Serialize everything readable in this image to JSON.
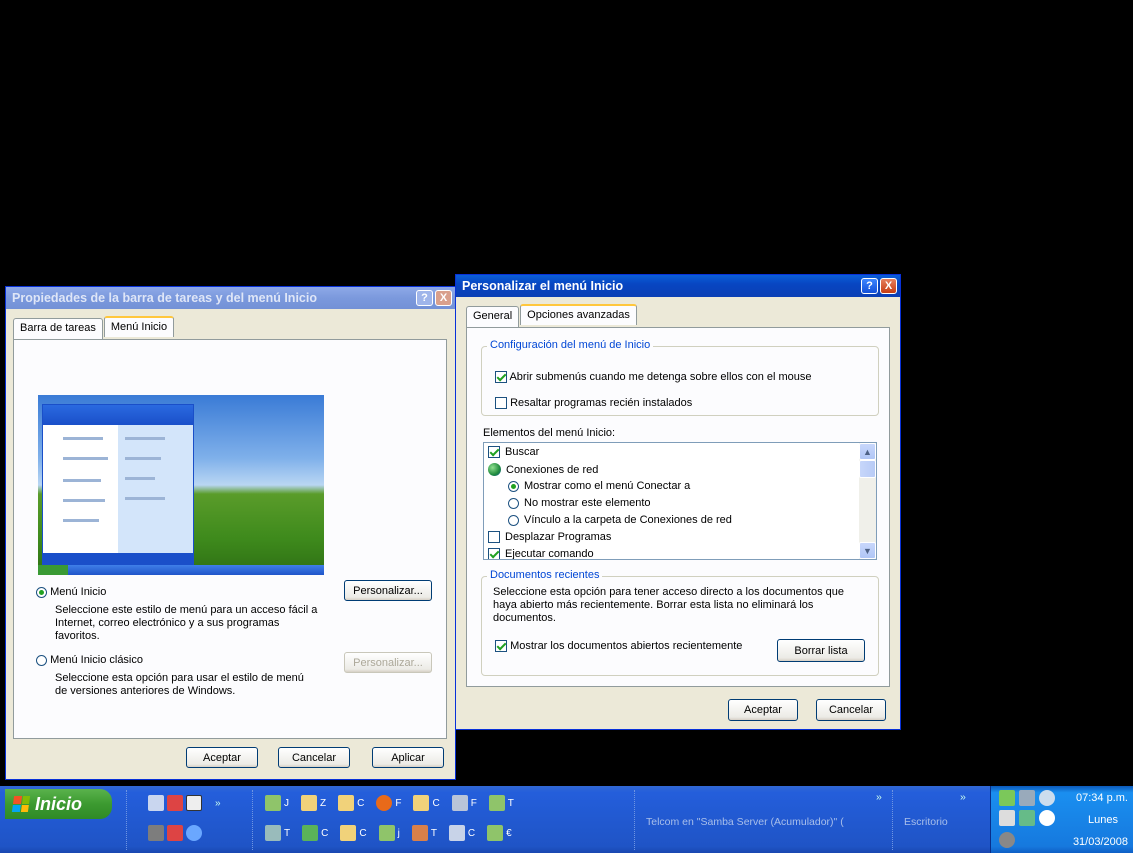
{
  "left_dialog": {
    "title": "Propiedades de la barra de tareas y del menú Inicio",
    "help_label": "?",
    "close_label": "X",
    "tabs": [
      "Barra de tareas",
      "Menú Inicio"
    ],
    "active_tab": "Menú Inicio",
    "option_start_menu": {
      "label": "Menú Inicio",
      "description": "Seleccione este estilo de menú para un acceso fácil a Internet, correo electrónico y a sus programas favoritos.",
      "selected": true,
      "customize_button": "Personalizar..."
    },
    "option_classic_menu": {
      "label": "Menú Inicio clásico",
      "description": "Seleccione esta opción para usar el estilo de menú de versiones anteriores de Windows.",
      "selected": false,
      "customize_button": "Personalizar..."
    },
    "buttons": {
      "ok": "Aceptar",
      "cancel": "Cancelar",
      "apply": "Aplicar"
    }
  },
  "right_dialog": {
    "title": "Personalizar el menú Inicio",
    "help_label": "?",
    "close_label": "X",
    "tabs": [
      "General",
      "Opciones avanzadas"
    ],
    "active_tab": "Opciones avanzadas",
    "config_group": {
      "label": "Configuración del menú de Inicio",
      "open_submenus": {
        "label": "Abrir submenús cuando me detenga sobre ellos con el mouse",
        "checked": true
      },
      "highlight_new": {
        "label": "Resaltar programas recién instalados",
        "checked": false
      }
    },
    "items_label": "Elementos del menú Inicio:",
    "items": [
      {
        "type": "checkbox",
        "label": "Buscar",
        "checked": true
      },
      {
        "type": "header",
        "label": "Conexiones de red"
      },
      {
        "type": "radio",
        "label": "Mostrar como el menú Conectar a",
        "selected": true
      },
      {
        "type": "radio",
        "label": "No mostrar este elemento",
        "selected": false
      },
      {
        "type": "radio",
        "label": "Vínculo a la carpeta de Conexiones de red",
        "selected": false
      },
      {
        "type": "checkbox",
        "label": "Desplazar Programas",
        "checked": false
      },
      {
        "type": "checkbox",
        "label": "Ejecutar comando",
        "checked": true
      }
    ],
    "recent_group": {
      "label": "Documentos recientes",
      "description": "Seleccione esta opción para tener acceso directo a los documentos que haya abierto más recientemente. Borrar esta lista no eliminará los documentos.",
      "show_recent": {
        "label": "Mostrar los documentos abiertos recientemente",
        "checked": true
      },
      "clear_button": "Borrar lista"
    },
    "buttons": {
      "ok": "Aceptar",
      "cancel": "Cancelar"
    }
  },
  "taskbar": {
    "start_label": "Inicio",
    "chevron": "»",
    "row1_items": [
      "J",
      "Z",
      "C",
      "F",
      "C",
      "F",
      "T"
    ],
    "row2_items": [
      "T",
      "C",
      "C",
      "j",
      "T",
      "C",
      "€"
    ],
    "telcom_label": "Telcom en \"Samba Server (Acumulador)\" (",
    "desktop_label": "Escritorio",
    "clock": {
      "time": "07:34 p.m.",
      "day": "Lunes",
      "date": "31/03/2008"
    }
  }
}
